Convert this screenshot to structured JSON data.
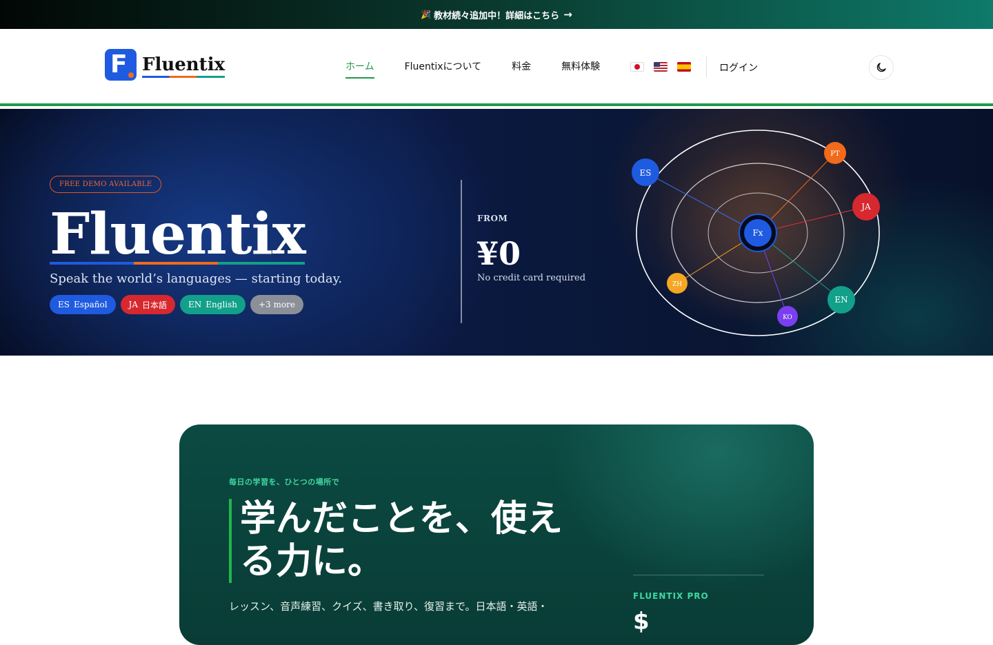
{
  "announcement": {
    "icon": "party-popper-icon",
    "text": "教材続々追加中！詳細はこちら",
    "arrow": "→"
  },
  "header": {
    "logo_word": "Fluentix",
    "nav": [
      "ホーム",
      "Fluentixについて",
      "料金",
      "無料体験"
    ],
    "active_nav": "ホーム",
    "flags": [
      "japan-flag-icon",
      "us-flag-icon",
      "spain-flag-icon"
    ],
    "login": "ログイン",
    "theme_toggle": "moon-icon"
  },
  "hero": {
    "badge": "FREE DEMO AVAILABLE",
    "title": "Fluentix",
    "subtitle": "Speak the world’s languages — starting today.",
    "chips": [
      {
        "code": "ES",
        "label": "Español"
      },
      {
        "code": "JA",
        "label": "日本語"
      },
      {
        "code": "EN",
        "label": "English"
      }
    ],
    "more_chip": "+3 more",
    "from_label": "FROM",
    "price": "¥0",
    "price_note": "No credit card required",
    "orbit": {
      "center": "Fx",
      "nodes": [
        "ES",
        "PT",
        "JA",
        "ZH",
        "EN",
        "KO"
      ]
    }
  },
  "pro_card": {
    "eyebrow": "毎日の学習を、ひとつの場所で",
    "title": "学んだことを、使える力に。",
    "description": "レッスン、音声練習、クイズ、書き取り、復習まで。日本語・英語・",
    "plan_label": "FLUENTIX PRO",
    "plan_price": "$"
  },
  "colors": {
    "brand_blue": "#1f5be0",
    "brand_orange": "#f26a1b",
    "brand_teal": "#12a08a",
    "accent_green": "#1f9a4a",
    "japanese_red": "#d7282f"
  }
}
